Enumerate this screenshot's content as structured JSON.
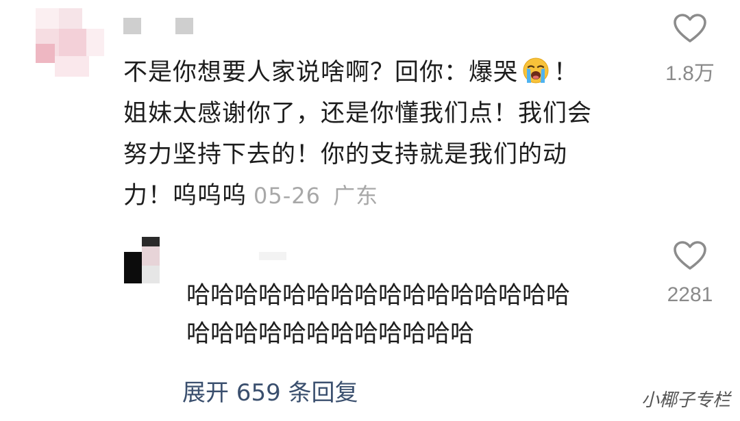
{
  "comment": {
    "lines": [
      "不是你想要人家说啥啊？回你：爆哭",
      "！",
      "姐妹太感谢你了，还是你懂我们点！我们会",
      "努力坚持下去的！你的支持就是我们的动",
      "力！呜呜呜"
    ],
    "emoji_icon": "loudly-crying-face-icon",
    "date": "05-26",
    "location": "广东",
    "like_count": "1.8万"
  },
  "reply": {
    "lines": [
      "哈哈哈哈哈哈哈哈哈哈哈哈哈哈哈哈",
      "哈哈哈哈哈哈哈哈哈哈哈哈"
    ],
    "like_count": "2281"
  },
  "expand": {
    "label": "展开 659 条回复"
  },
  "watermark": {
    "text": "小椰子专栏"
  },
  "colors": {
    "text": "#1d1d1d",
    "meta": "#a8a8a8",
    "like_count": "#8a8a8a",
    "heart_stroke": "#8c8c8c",
    "link": "#3a4f6e"
  },
  "icons": {
    "like": "heart-outline-icon",
    "emoji": "loudly-crying-face-icon"
  }
}
